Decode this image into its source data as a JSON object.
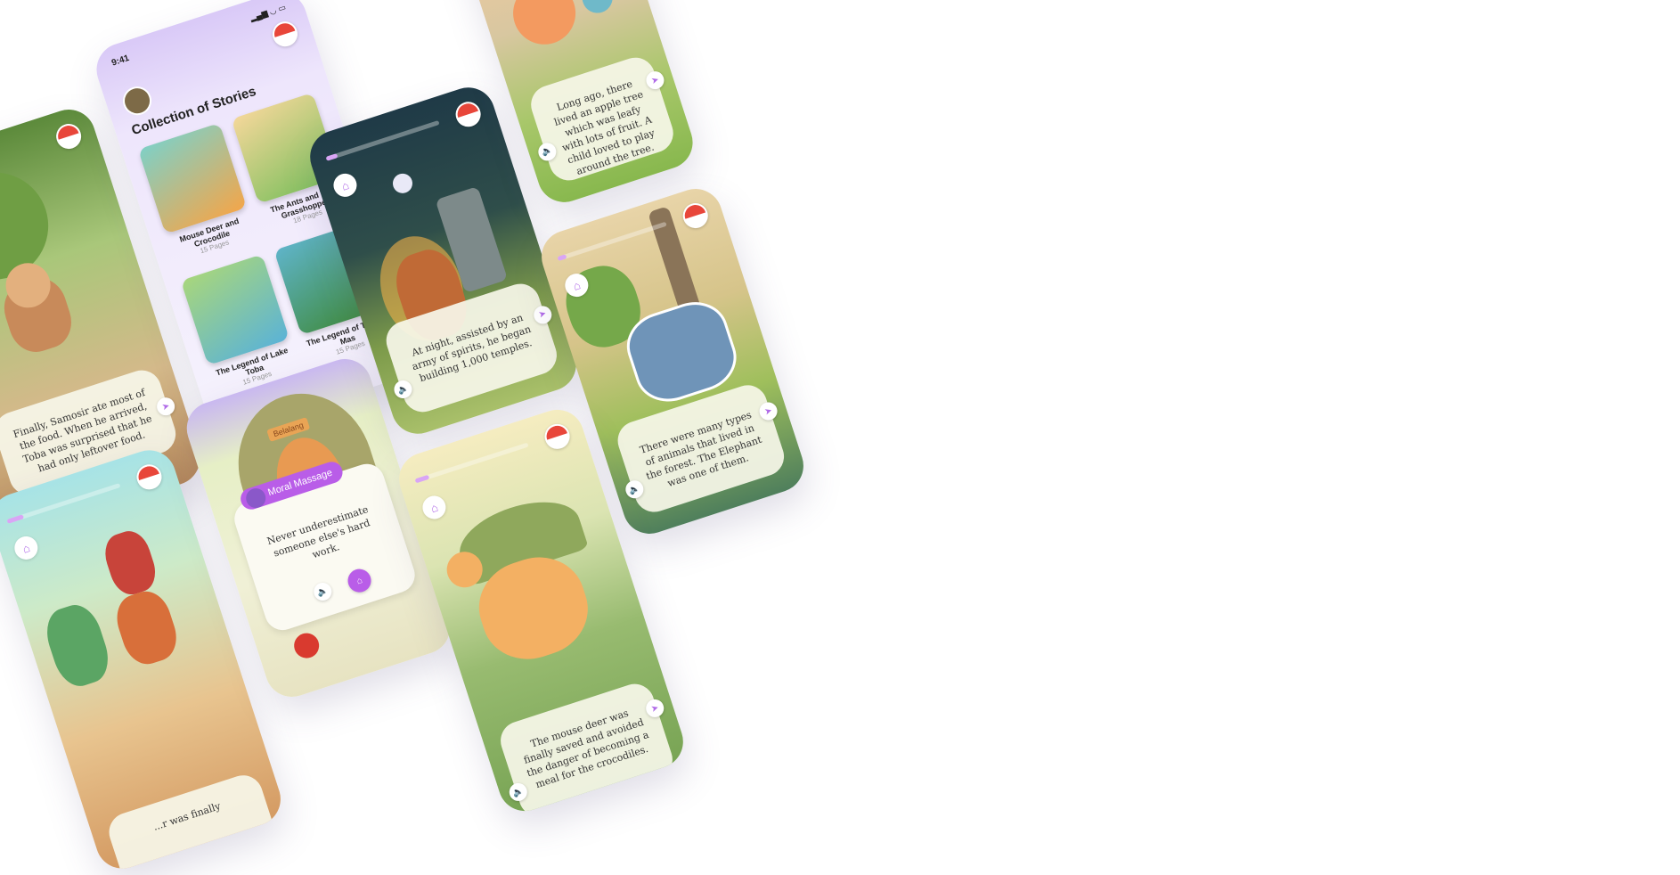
{
  "colors": {
    "accent": "#b06ae8",
    "flag_red": "#e8463a",
    "card_bg": "#f6f6e8",
    "moral_badge": "#b95de8"
  },
  "collection": {
    "status_time": "9:41",
    "title": "Collection of Stories",
    "stories": [
      {
        "title": "Mouse Deer and Crocodile",
        "pages": "15 Pages"
      },
      {
        "title": "The Ants and The Grasshopper",
        "pages": "18 Pages"
      },
      {
        "title": "The Legend of Lake Toba",
        "pages": "15 Pages"
      },
      {
        "title": "The Legend of Timun Mas",
        "pages": "15 Pages"
      }
    ]
  },
  "pages": {
    "samosir": "Finally, Samosir ate most of the food. When he arrived, Toba was surprised that he had only leftover food.",
    "temples": "At night, assisted by an army of spirits, he began building 1,000 temples.",
    "apple_tree": "Long ago, there lived an apple tree which was leafy with lots of fruit. A child loved to play around the tree.",
    "elephant": "There were many types of animals that lived in the forest. The Elephant was one of them.",
    "mouse_deer": "The mouse deer was finally saved and avoided the danger of becoming a meal for the crocodiles.",
    "kids": "...r was finally"
  },
  "moral": {
    "sign": "Belalang",
    "badge": "Moral Massage",
    "text": "Never underestimate someone else's hard work."
  }
}
